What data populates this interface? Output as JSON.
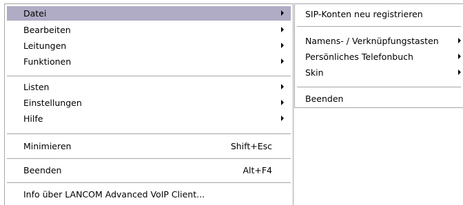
{
  "main_menu": {
    "items": [
      {
        "label": "Datei",
        "submenu_arrow": "arrow-right-icon"
      },
      {
        "label": "Bearbeiten",
        "submenu_arrow": "arrow-right-icon"
      },
      {
        "label": "Leitungen",
        "submenu_arrow": "arrow-right-icon"
      },
      {
        "label": "Funktionen",
        "submenu_arrow": "arrow-right-icon"
      },
      {
        "label": "Listen",
        "submenu_arrow": "arrow-right-icon"
      },
      {
        "label": "Einstellungen",
        "submenu_arrow": "arrow-right-icon"
      },
      {
        "label": "Hilfe",
        "submenu_arrow": "arrow-right-icon"
      },
      {
        "label": "Minimieren",
        "shortcut": "Shift+Esc"
      },
      {
        "label": "Beenden",
        "shortcut": "Alt+F4"
      },
      {
        "label": "Info über LANCOM Advanced VoIP Client..."
      }
    ],
    "selected_label": "Datei",
    "highlight_color": "#b0acc6"
  },
  "sub_menu": {
    "items": [
      {
        "label": "SIP-Konten neu registrieren"
      },
      {
        "label": "Namens- / Verknüpfungstasten",
        "submenu_arrow": "arrow-right-icon"
      },
      {
        "label": "Persönliches Telefonbuch",
        "submenu_arrow": "arrow-right-icon"
      },
      {
        "label": "Skin",
        "submenu_arrow": "arrow-right-icon"
      },
      {
        "label": "Beenden"
      }
    ]
  }
}
